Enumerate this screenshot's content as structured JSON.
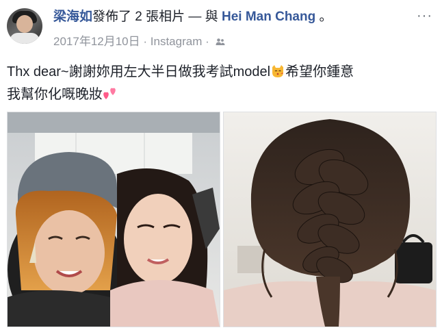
{
  "post": {
    "author": "梁海如",
    "action": "發佈了 2 張相片",
    "separator": "— 與",
    "tagged": "Hei Man Chang",
    "end_mark": "。",
    "date": "2017年12月10日",
    "dot": "·",
    "source": "Instagram",
    "more_label": "···",
    "caption_line1": "Thx dear~謝謝妳用左大半日做我考試model",
    "caption_line1b": "希望你鍾意",
    "caption_line2": "我幫你化嘅晚妝",
    "icons": {
      "avatar": "profile-photo",
      "audience": "friends-icon",
      "emoji1": "kissing-cat-emoji",
      "emoji2": "two-hearts-emoji",
      "more": "ellipsis-icon"
    }
  },
  "photos": [
    {
      "name": "selfie-photo"
    },
    {
      "name": "braid-photo"
    }
  ]
}
